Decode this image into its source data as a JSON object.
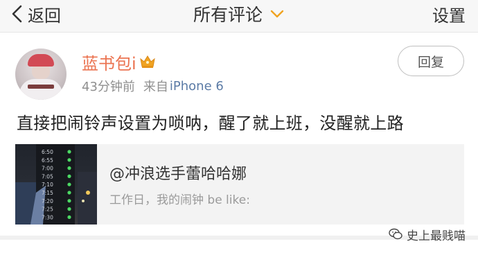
{
  "nav": {
    "back_label": "返回",
    "title": "所有评论",
    "settings_label": "设置"
  },
  "comment": {
    "username": "蓝书包i",
    "time": "43分钟前",
    "source_prefix": "来自",
    "device": "iPhone 6",
    "reply_label": "回复",
    "text": "直接把闹铃声设置为唢呐，醒了就上班，没醒就上路"
  },
  "quoted": {
    "user": "@冲浪选手蕾哈哈娜",
    "text": "工作日，我的闹钟 be like:",
    "alarm_times": [
      "6:50",
      "6:55",
      "7:00",
      "7:05",
      "7:10",
      "7:15",
      "7:20",
      "7:25",
      "7:30"
    ]
  },
  "watermark": "史上最贱喵",
  "colors": {
    "username": "#eb7350",
    "device": "#5b7ba6",
    "crown": "#f0a321"
  }
}
